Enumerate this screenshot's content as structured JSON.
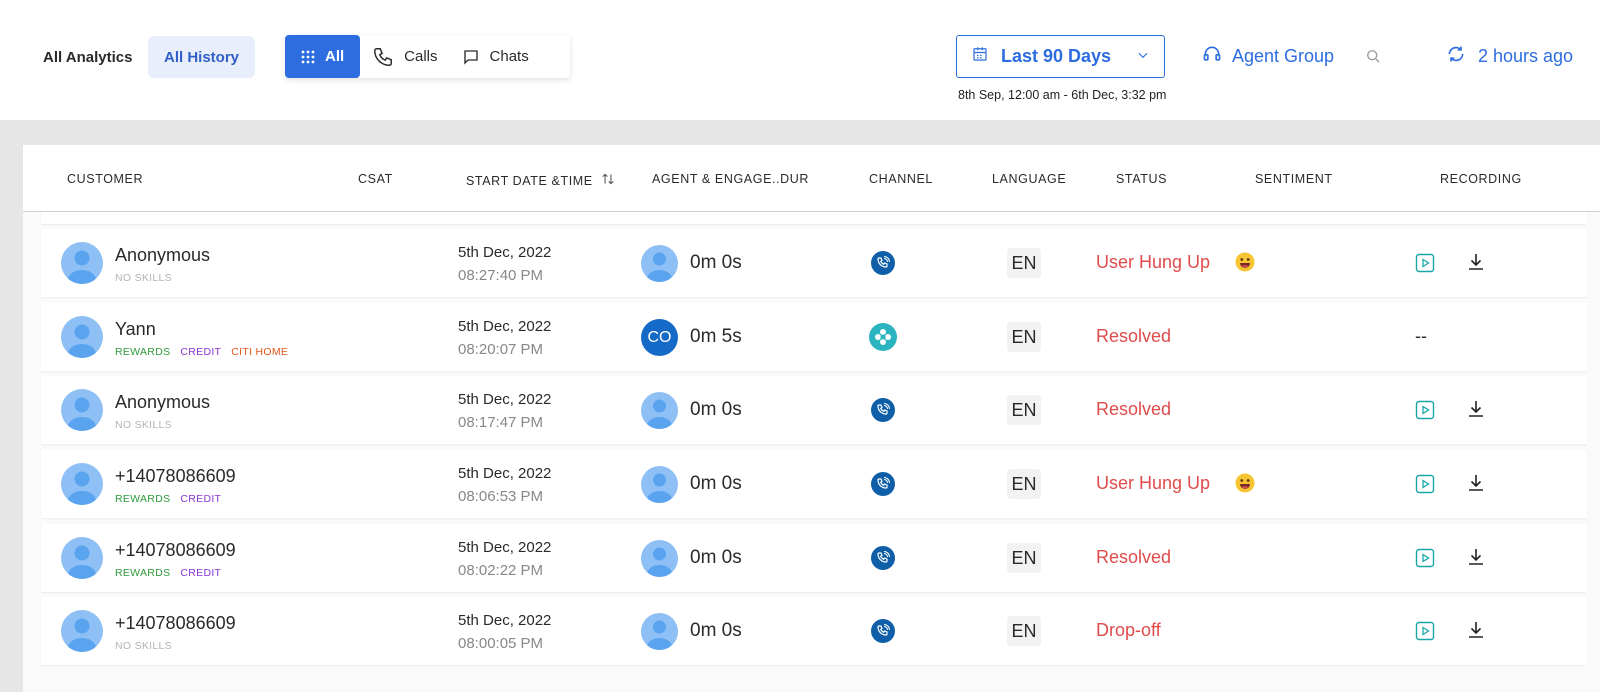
{
  "header": {
    "nav_analytics": "All Analytics",
    "nav_history": "All History",
    "channels": {
      "all": "All",
      "calls": "Calls",
      "chats": "Chats"
    },
    "date_filter": "Last 90 Days",
    "date_range": "8th Sep, 12:00 am - 6th Dec, 3:32 pm",
    "agent_group": "Agent Group",
    "refresh_label": "2 hours ago"
  },
  "colors": {
    "accent": "#2d6ddf",
    "status_red": "#e04b4b",
    "tag_green": "#2e9b3b",
    "tag_purple": "#8a35d6",
    "tag_orange": "#e5561b"
  },
  "table": {
    "columns": [
      "CUSTOMER",
      "CSAT",
      "START DATE &TIME",
      "AGENT & ENGAGE..DUR",
      "CHANNEL",
      "LANGUAGE",
      "STATUS",
      "SENTIMENT",
      "RECORDING"
    ],
    "rows": [
      {
        "name": "Anonymous",
        "tags": [
          {
            "label": "NO SKILLS",
            "kind": "nos"
          }
        ],
        "date": "5th Dec, 2022",
        "time": "08:27:40 PM",
        "agent": "avatar",
        "duration": "0m 0s",
        "channel": "phone-icon",
        "language": "EN",
        "status": "User Hung Up",
        "sentiment": "smile-emoji",
        "recording": "play-download"
      },
      {
        "name": "Yann",
        "tags": [
          {
            "label": "REWARDS",
            "kind": "rew"
          },
          {
            "label": "CREDIT",
            "kind": "cre"
          },
          {
            "label": "CITI HOME",
            "kind": "citi"
          }
        ],
        "date": "5th Dec, 2022",
        "time": "08:20:07 PM",
        "agent": "CO",
        "duration": "0m 5s",
        "channel": "chat-icon",
        "language": "EN",
        "status": "Resolved",
        "sentiment": "",
        "recording": "--"
      },
      {
        "name": "Anonymous",
        "tags": [
          {
            "label": "NO SKILLS",
            "kind": "nos"
          }
        ],
        "date": "5th Dec, 2022",
        "time": "08:17:47 PM",
        "agent": "avatar",
        "duration": "0m 0s",
        "channel": "phone-icon",
        "language": "EN",
        "status": "Resolved",
        "sentiment": "",
        "recording": "play-download"
      },
      {
        "name": "+14078086609",
        "tags": [
          {
            "label": "REWARDS",
            "kind": "rew"
          },
          {
            "label": "CREDIT",
            "kind": "cre"
          }
        ],
        "date": "5th Dec, 2022",
        "time": "08:06:53 PM",
        "agent": "avatar",
        "duration": "0m 0s",
        "channel": "phone-icon",
        "language": "EN",
        "status": "User Hung Up",
        "sentiment": "smile-emoji",
        "recording": "play-download"
      },
      {
        "name": "+14078086609",
        "tags": [
          {
            "label": "REWARDS",
            "kind": "rew"
          },
          {
            "label": "CREDIT",
            "kind": "cre"
          }
        ],
        "date": "5th Dec, 2022",
        "time": "08:02:22 PM",
        "agent": "avatar",
        "duration": "0m 0s",
        "channel": "phone-icon",
        "language": "EN",
        "status": "Resolved",
        "sentiment": "",
        "recording": "play-download"
      },
      {
        "name": "+14078086609",
        "tags": [
          {
            "label": "NO SKILLS",
            "kind": "nos"
          }
        ],
        "date": "5th Dec, 2022",
        "time": "08:00:05 PM",
        "agent": "avatar",
        "duration": "0m 0s",
        "channel": "phone-icon",
        "language": "EN",
        "status": "Drop-off",
        "sentiment": "",
        "recording": "play-download"
      }
    ]
  }
}
